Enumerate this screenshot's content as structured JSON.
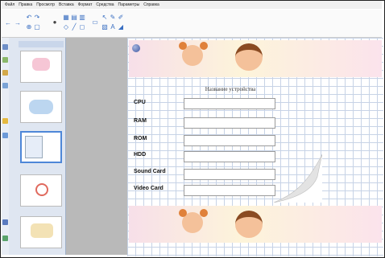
{
  "menu": [
    "Файл",
    "Правка",
    "Просмотр",
    "Вставка",
    "Формат",
    "Средства",
    "Параметры",
    "Справка"
  ],
  "worksheet": {
    "title": "Название устройства",
    "rows": [
      {
        "label": "CPU",
        "value": ""
      },
      {
        "label": "RAM",
        "value": ""
      },
      {
        "label": "ROM",
        "value": ""
      },
      {
        "label": "HDD",
        "value": ""
      },
      {
        "label": "Sound Card",
        "value": ""
      },
      {
        "label": "Video Card",
        "value": ""
      }
    ]
  },
  "colors": {
    "accent": "#4e87d8",
    "grid": "#c7d3e6",
    "panel": "#dfe6f1"
  },
  "icons": [
    "back-arrow-icon",
    "forward-arrow-icon",
    "undo-icon",
    "redo-icon",
    "pen-icon",
    "eraser-icon",
    "shape-icon",
    "text-icon",
    "select-icon"
  ]
}
